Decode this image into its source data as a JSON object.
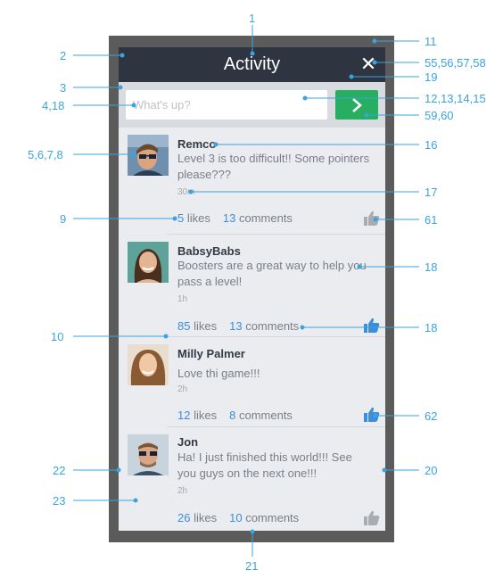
{
  "header": {
    "title": "Activity",
    "close_label": "✕"
  },
  "compose": {
    "placeholder": "What's up?"
  },
  "posts": [
    {
      "name": "Remco",
      "text": "Level 3 is too difficult!! Some pointers please???",
      "time": "30m",
      "likes": "5",
      "likes_label": "likes",
      "comments": "13",
      "comments_label": "comments",
      "liked": false
    },
    {
      "name": "BabsyBabs",
      "text": "Boosters are a great way to help you pass a level!",
      "time": "1h",
      "likes": "85",
      "likes_label": "likes",
      "comments": "13",
      "comments_label": "comments",
      "liked": true
    },
    {
      "name": "Milly Palmer",
      "text": "Love thi game!!!",
      "time": "2h",
      "likes": "12",
      "likes_label": "likes",
      "comments": "8",
      "comments_label": "comments",
      "liked": true
    },
    {
      "name": "Jon",
      "text": "Ha! I just finished this world!!! See you guys on the next one!!!",
      "time": "2h",
      "likes": "26",
      "likes_label": "likes",
      "comments": "10",
      "comments_label": "comments",
      "liked": false
    }
  ],
  "callouts": {
    "c1": "1",
    "c2": "2",
    "c3": "3",
    "c4": "4,18",
    "c5": "5,6,7,8",
    "c9": "9",
    "c10": "10",
    "c22": "22",
    "c23": "23",
    "c11": "11",
    "c55": "55,56,57,58",
    "c19": "19",
    "c12": "12,13,14,15",
    "c59": "59,60",
    "c16": "16",
    "c17": "17",
    "c61": "61",
    "c18a": "18",
    "c18b": "18",
    "c62": "62",
    "c20": "20",
    "c21": "21"
  },
  "colors": {
    "accent": "#3aa4de",
    "header": "#2f3540",
    "send": "#27ae60",
    "like_active": "#3b8edb",
    "like_inactive": "#a9acb1"
  },
  "icons": {
    "close": "close-icon",
    "send": "chevron-right-icon",
    "like": "thumbs-up-icon"
  }
}
